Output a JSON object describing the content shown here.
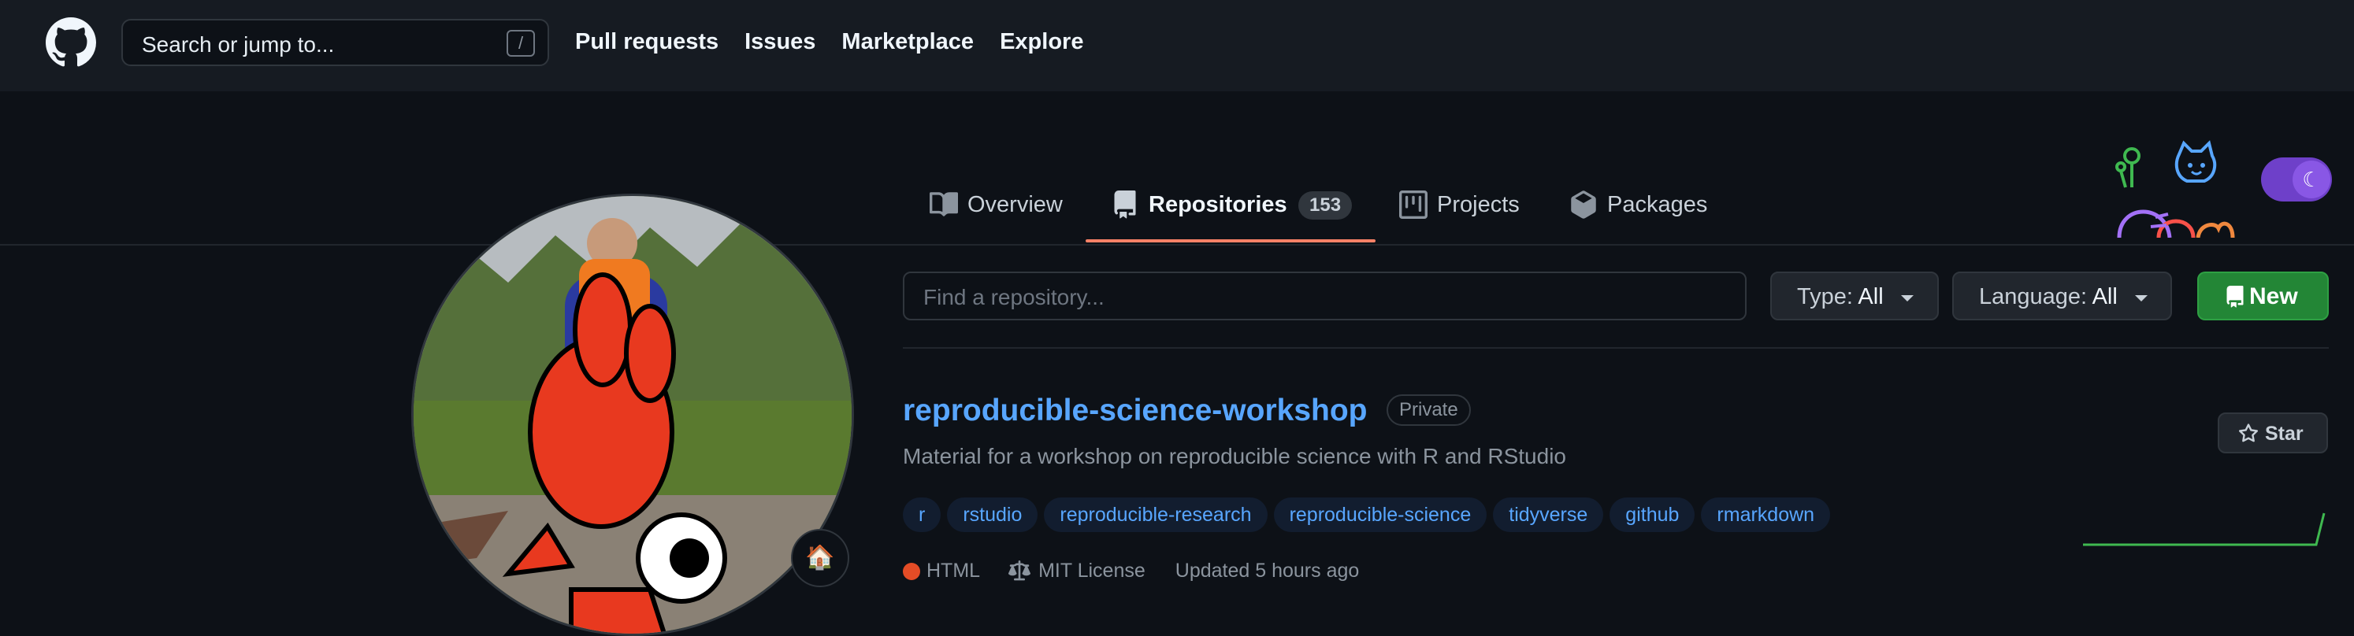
{
  "header": {
    "logo": "github-mark-icon",
    "search_placeholder": "Search or jump to...",
    "search_shortcut": "/",
    "nav": [
      "Pull requests",
      "Issues",
      "Marketplace",
      "Explore"
    ]
  },
  "tabs": [
    {
      "label": "Overview",
      "icon": "book-icon"
    },
    {
      "label": "Repositories",
      "icon": "repo-icon",
      "count": "153",
      "active": true
    },
    {
      "label": "Projects",
      "icon": "project-icon"
    },
    {
      "label": "Packages",
      "icon": "package-icon"
    }
  ],
  "profile": {
    "status_emoji": "🏠"
  },
  "filters": {
    "find_placeholder": "Find a repository...",
    "type_label": "Type:",
    "type_value": "All",
    "language_label": "Language:",
    "language_value": "All",
    "new_label": "New"
  },
  "repo": {
    "name": "reproducible-science-workshop",
    "visibility": "Private",
    "description": "Material for a workshop on reproducible science with R and RStudio",
    "topics": [
      "r",
      "rstudio",
      "reproducible-research",
      "reproducible-science",
      "tidyverse",
      "github",
      "rmarkdown"
    ],
    "language": "HTML",
    "language_color": "#e34c26",
    "license": "MIT License",
    "updated": "Updated 5 hours ago",
    "star_label": "Star"
  },
  "theme": {
    "mode_icon": "moon-icon",
    "toggle_color": "#6e40c9"
  },
  "colors": {
    "accent": "#58a6ff",
    "tab_underline": "#f78166",
    "new_button": "#238636"
  }
}
